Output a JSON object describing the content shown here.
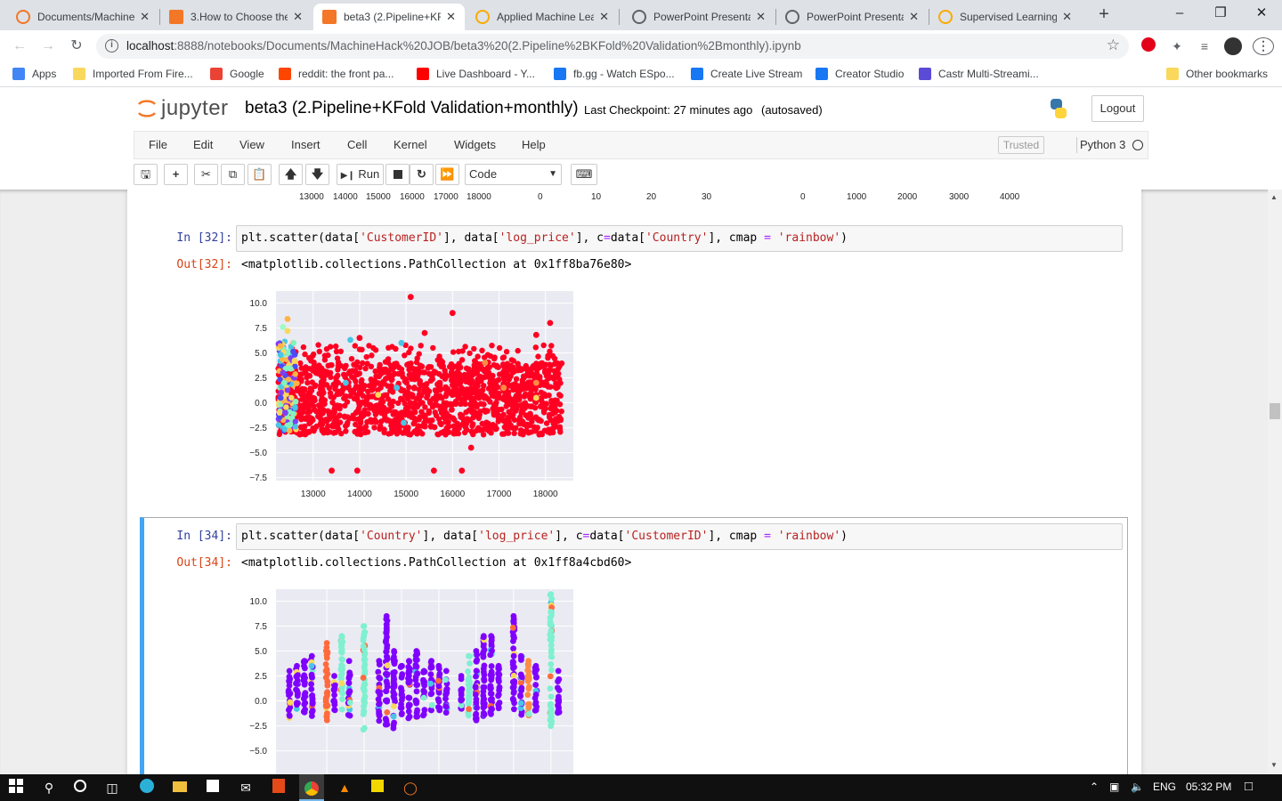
{
  "browser": {
    "tabs": [
      {
        "title": "Documents/Machine",
        "icon": "jupyter-icon",
        "active": false
      },
      {
        "title": "3.How to Choose the",
        "icon": "notebook-icon",
        "active": false
      },
      {
        "title": "beta3 (2.Pipeline+KF",
        "icon": "notebook-icon",
        "active": true
      },
      {
        "title": "Applied Machine Lea",
        "icon": "colab-icon",
        "active": false
      },
      {
        "title": "PowerPoint Presenta",
        "icon": "globe-icon",
        "active": false
      },
      {
        "title": "PowerPoint Presenta",
        "icon": "globe-icon",
        "active": false
      },
      {
        "title": "Supervised Learning",
        "icon": "colab-icon",
        "active": false
      }
    ],
    "url_host": "localhost",
    "url_rest": ":8888/notebooks/Documents/MachineHack%20JOB/beta3%20(2.Pipeline%2BKFold%20Validation%2Bmonthly).ipynb",
    "bookmarks": [
      {
        "label": "Apps",
        "color": "#4285f4"
      },
      {
        "label": "Imported From Fire...",
        "color": "#f9d85c"
      },
      {
        "label": "Google",
        "color": "#ea4335"
      },
      {
        "label": "reddit: the front pa...",
        "color": "#ff4500"
      },
      {
        "label": "Live Dashboard - Y...",
        "color": "#ff0000"
      },
      {
        "label": "fb.gg - Watch ESpo...",
        "color": "#1877f2"
      },
      {
        "label": "Create Live Stream",
        "color": "#1877f2"
      },
      {
        "label": "Creator Studio",
        "color": "#1877f2"
      },
      {
        "label": "Castr Multi-Streami...",
        "color": "#5b4bd6"
      }
    ],
    "other_bookmarks": "Other bookmarks"
  },
  "jupyter": {
    "logo_text": "jupyter",
    "notebook_name": "beta3 (2.Pipeline+KFold Validation+monthly)",
    "checkpoint": "Last Checkpoint: 27 minutes ago",
    "autosave": "(autosaved)",
    "logout": "Logout",
    "menu": [
      "File",
      "Edit",
      "View",
      "Insert",
      "Cell",
      "Kernel",
      "Widgets",
      "Help"
    ],
    "trusted": "Trusted",
    "kernel": "Python 3",
    "toolbar": {
      "run": "Run",
      "cell_type": "Code"
    }
  },
  "top_fragment_ticks": {
    "a": [
      "13000",
      "14000",
      "15000",
      "16000",
      "17000",
      "18000"
    ],
    "b": [
      "0",
      "10",
      "20",
      "30"
    ],
    "c": [
      "0",
      "1000",
      "2000",
      "3000",
      "4000"
    ]
  },
  "cells": [
    {
      "in_prompt": "In [32]:",
      "code_parts": [
        "plt.scatter(data[",
        "'CustomerID'",
        "], data[",
        "'log_price'",
        "], c",
        "=",
        "data[",
        "'Country'",
        "], cmap ",
        "=",
        " ",
        "'rainbow'",
        ")"
      ],
      "out_prompt": "Out[32]:",
      "out_text": "<matplotlib.collections.PathCollection at 0x1ff8ba76e80>"
    },
    {
      "in_prompt": "In [34]:",
      "code_parts": [
        "plt.scatter(data[",
        "'Country'",
        "], data[",
        "'log_price'",
        "], c",
        "=",
        "data[",
        "'CustomerID'",
        "], cmap ",
        "=",
        " ",
        "'rainbow'",
        ")"
      ],
      "out_prompt": "Out[34]:",
      "out_text": "<matplotlib.collections.PathCollection at 0x1ff8a4cbd60>"
    }
  ],
  "chart_data": [
    {
      "type": "scatter",
      "xlim": [
        12200,
        18600
      ],
      "ylim": [
        -7.8,
        11.2
      ],
      "x_ticks": [
        13000,
        14000,
        15000,
        16000,
        17000,
        18000
      ],
      "y_ticks": [
        10.0,
        7.5,
        5.0,
        2.5,
        0.0,
        -2.5,
        -5.0,
        -7.5
      ],
      "x_tick_labels": [
        "13000",
        "14000",
        "15000",
        "16000",
        "17000",
        "18000"
      ],
      "y_tick_labels": [
        "10.0",
        "7.5",
        "5.0",
        "2.5",
        "0.0",
        "−2.5",
        "−5.0",
        "−7.5"
      ],
      "cmap": "rainbow",
      "grid": true,
      "dominant_band": {
        "x": [
          12250,
          18350
        ],
        "y": [
          -3.2,
          4.0
        ],
        "color": "#ff0022"
      },
      "points": [
        {
          "x": 15100,
          "y": 10.6,
          "c": "#ff0022"
        },
        {
          "x": 16000,
          "y": 9.0,
          "c": "#ff0022"
        },
        {
          "x": 18100,
          "y": 8.0,
          "c": "#ff0022"
        },
        {
          "x": 12450,
          "y": 8.4,
          "c": "#ffb347"
        },
        {
          "x": 12350,
          "y": 7.6,
          "c": "#9dfbc9"
        },
        {
          "x": 12450,
          "y": 7.2,
          "c": "#f9d85c"
        },
        {
          "x": 14000,
          "y": 6.5,
          "c": "#ff0022"
        },
        {
          "x": 15400,
          "y": 7.0,
          "c": "#ff0022"
        },
        {
          "x": 17800,
          "y": 6.8,
          "c": "#ff0022"
        },
        {
          "x": 13800,
          "y": 6.3,
          "c": "#47c6e7"
        },
        {
          "x": 14900,
          "y": 6.0,
          "c": "#47c6e7"
        },
        {
          "x": 12300,
          "y": 4.8,
          "c": "#47c6e7"
        },
        {
          "x": 12350,
          "y": 3.0,
          "c": "#7f3ff5"
        },
        {
          "x": 12300,
          "y": 0.5,
          "c": "#4b4bf5"
        },
        {
          "x": 12400,
          "y": -1.0,
          "c": "#7f3ff5"
        },
        {
          "x": 12380,
          "y": 2.0,
          "c": "#82f3c0"
        },
        {
          "x": 12500,
          "y": -2.2,
          "c": "#82f3c0"
        },
        {
          "x": 12600,
          "y": 4.2,
          "c": "#f9d85c"
        },
        {
          "x": 14800,
          "y": 1.5,
          "c": "#47c6e7"
        },
        {
          "x": 14950,
          "y": -2.0,
          "c": "#47c6e7"
        },
        {
          "x": 14400,
          "y": 0.8,
          "c": "#f9d85c"
        },
        {
          "x": 13700,
          "y": 2.0,
          "c": "#47c6e7"
        },
        {
          "x": 17100,
          "y": 1.5,
          "c": "#ff8c42"
        },
        {
          "x": 17800,
          "y": 2.0,
          "c": "#ff8c42"
        },
        {
          "x": 17800,
          "y": 0.5,
          "c": "#f9d85c"
        },
        {
          "x": 16700,
          "y": 4.0,
          "c": "#ff8c42"
        },
        {
          "x": 16400,
          "y": -4.5,
          "c": "#ff0022"
        },
        {
          "x": 13400,
          "y": -6.8,
          "c": "#ff0022"
        },
        {
          "x": 13950,
          "y": -6.8,
          "c": "#ff0022"
        },
        {
          "x": 15600,
          "y": -6.8,
          "c": "#ff0022"
        },
        {
          "x": 16200,
          "y": -6.8,
          "c": "#ff0022"
        }
      ]
    },
    {
      "type": "scatter",
      "xlim": [
        -1.8,
        38.0
      ],
      "ylim": [
        -7.8,
        11.2
      ],
      "y_ticks": [
        10.0,
        7.5,
        5.0,
        2.5,
        0.0,
        -2.5,
        -5.0
      ],
      "y_tick_labels": [
        "10.0",
        "7.5",
        "5.0",
        "2.5",
        "0.0",
        "−2.5",
        "−5.0"
      ],
      "cmap": "rainbow",
      "grid": true,
      "columns": [
        {
          "x": 0,
          "ymin": -1.8,
          "ymax": 3.0,
          "c": "#8000ff"
        },
        {
          "x": 1,
          "ymin": -1.5,
          "ymax": 3.5,
          "c": "#8000ff"
        },
        {
          "x": 2,
          "ymin": -1.2,
          "ymax": 4.0,
          "c": "#8000ff"
        },
        {
          "x": 3,
          "ymin": -1.8,
          "ymax": 4.5,
          "c": "#8000ff"
        },
        {
          "x": 5,
          "ymin": -2.2,
          "ymax": 5.8,
          "c": "#ff6a3d"
        },
        {
          "x": 6,
          "ymin": -1.2,
          "ymax": 2.5,
          "c": "#8000ff"
        },
        {
          "x": 7,
          "ymin": -1.0,
          "ymax": 6.5,
          "c": "#7ff0d0"
        },
        {
          "x": 8,
          "ymin": -1.5,
          "ymax": 4.0,
          "c": "#8000ff"
        },
        {
          "x": 10,
          "ymin": -3.0,
          "ymax": 7.5,
          "c": "#7ff0d0"
        },
        {
          "x": 12,
          "ymin": -2.0,
          "ymax": 4.0,
          "c": "#8000ff"
        },
        {
          "x": 13,
          "ymin": -2.5,
          "ymax": 8.5,
          "c": "#8000ff"
        },
        {
          "x": 14,
          "ymin": -2.8,
          "ymax": 5.0,
          "c": "#8000ff"
        },
        {
          "x": 15,
          "ymin": -1.5,
          "ymax": 3.5,
          "c": "#8000ff"
        },
        {
          "x": 16,
          "ymin": -2.0,
          "ymax": 4.0,
          "c": "#8000ff"
        },
        {
          "x": 17,
          "ymin": -1.8,
          "ymax": 5.0,
          "c": "#8000ff"
        },
        {
          "x": 18,
          "ymin": -1.5,
          "ymax": 3.0,
          "c": "#8000ff"
        },
        {
          "x": 19,
          "ymin": -1.0,
          "ymax": 4.0,
          "c": "#8000ff"
        },
        {
          "x": 20,
          "ymin": -1.5,
          "ymax": 3.5,
          "c": "#8000ff"
        },
        {
          "x": 21,
          "ymin": -1.2,
          "ymax": 3.0,
          "c": "#8000ff"
        },
        {
          "x": 23,
          "ymin": -1.0,
          "ymax": 2.5,
          "c": "#8000ff"
        },
        {
          "x": 24,
          "ymin": -1.5,
          "ymax": 4.5,
          "c": "#7ff0d0"
        },
        {
          "x": 25,
          "ymin": -2.0,
          "ymax": 5.0,
          "c": "#8000ff"
        },
        {
          "x": 26,
          "ymin": -1.8,
          "ymax": 6.5,
          "c": "#8000ff"
        },
        {
          "x": 27,
          "ymin": -1.5,
          "ymax": 6.5,
          "c": "#8000ff"
        },
        {
          "x": 28,
          "ymin": -1.0,
          "ymax": 3.5,
          "c": "#8000ff"
        },
        {
          "x": 30,
          "ymin": -1.5,
          "ymax": 8.5,
          "c": "#8000ff"
        },
        {
          "x": 31,
          "ymin": -1.8,
          "ymax": 4.5,
          "c": "#8000ff"
        },
        {
          "x": 32,
          "ymin": -1.5,
          "ymax": 4.0,
          "c": "#ff8c42"
        },
        {
          "x": 33,
          "ymin": -1.0,
          "ymax": 3.5,
          "c": "#8000ff"
        },
        {
          "x": 35,
          "ymin": -3.0,
          "ymax": 10.7,
          "c": "#7ff0d0"
        },
        {
          "x": 36,
          "ymin": -1.5,
          "ymax": 3.0,
          "c": "#8000ff"
        }
      ]
    }
  ],
  "taskbar": {
    "lang": "ENG",
    "time": "05:32 PM"
  }
}
